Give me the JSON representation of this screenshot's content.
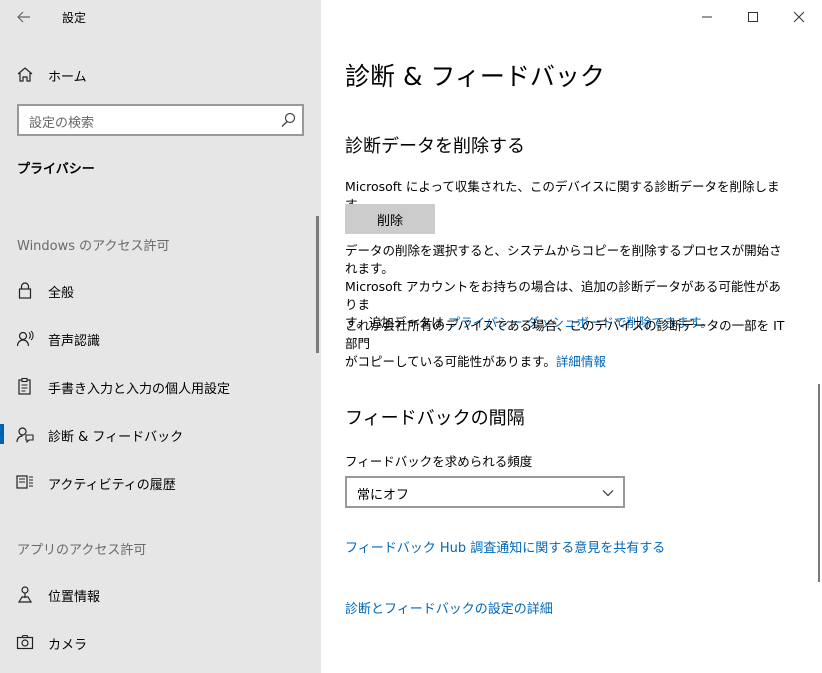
{
  "window": {
    "title": "設定"
  },
  "sidebar": {
    "home_label": "ホーム",
    "search_placeholder": "設定の検索",
    "section_title": "プライバシー",
    "groups": [
      {
        "label": "Windows のアクセス許可",
        "items": [
          {
            "label": "全般",
            "icon": "lock-icon"
          },
          {
            "label": "音声認識",
            "icon": "speech-icon"
          },
          {
            "label": "手書き入力と入力の個人用設定",
            "icon": "clipboard-icon"
          },
          {
            "label": "診断 & フィードバック",
            "icon": "feedback-icon",
            "active": true
          },
          {
            "label": "アクティビティの履歴",
            "icon": "activity-history-icon"
          }
        ]
      },
      {
        "label": "アプリのアクセス許可",
        "items": [
          {
            "label": "位置情報",
            "icon": "location-icon"
          },
          {
            "label": "カメラ",
            "icon": "camera-icon"
          }
        ]
      }
    ]
  },
  "main": {
    "title": "診断 & フィードバック",
    "delete_section": {
      "heading": "診断データを削除する",
      "description": "Microsoft によって収集された、このデバイスに関する診断データを削除します。",
      "button_label": "削除",
      "para1_line1": "データの削除を選択すると、システムからコピーを削除するプロセスが開始されます。",
      "para1_line2": "Microsoft アカウントをお持ちの場合は、追加の診断データがある可能性がありま",
      "para1_line3_prefix": "す。追加データは",
      "para1_link": "プライバシー ダッシュボードで削除できます。",
      "para2_line1": "これが会社所有のデバイスである場合、このデバイスの診断データの一部を IT 部門",
      "para2_line2_prefix": "がコピーしている可能性があります。",
      "para2_link": "詳細情報"
    },
    "feedback_section": {
      "heading": "フィードバックの間隔",
      "field_label": "フィードバックを求められる頻度",
      "selected_value": "常にオフ",
      "hub_link": "フィードバック Hub 調査通知に関する意見を共有する"
    },
    "details_link": "診断とフィードバックの設定の詳細"
  },
  "colors": {
    "accent": "#0063b1",
    "link": "#0067b8",
    "sidebar_bg": "#e6e6e6"
  }
}
